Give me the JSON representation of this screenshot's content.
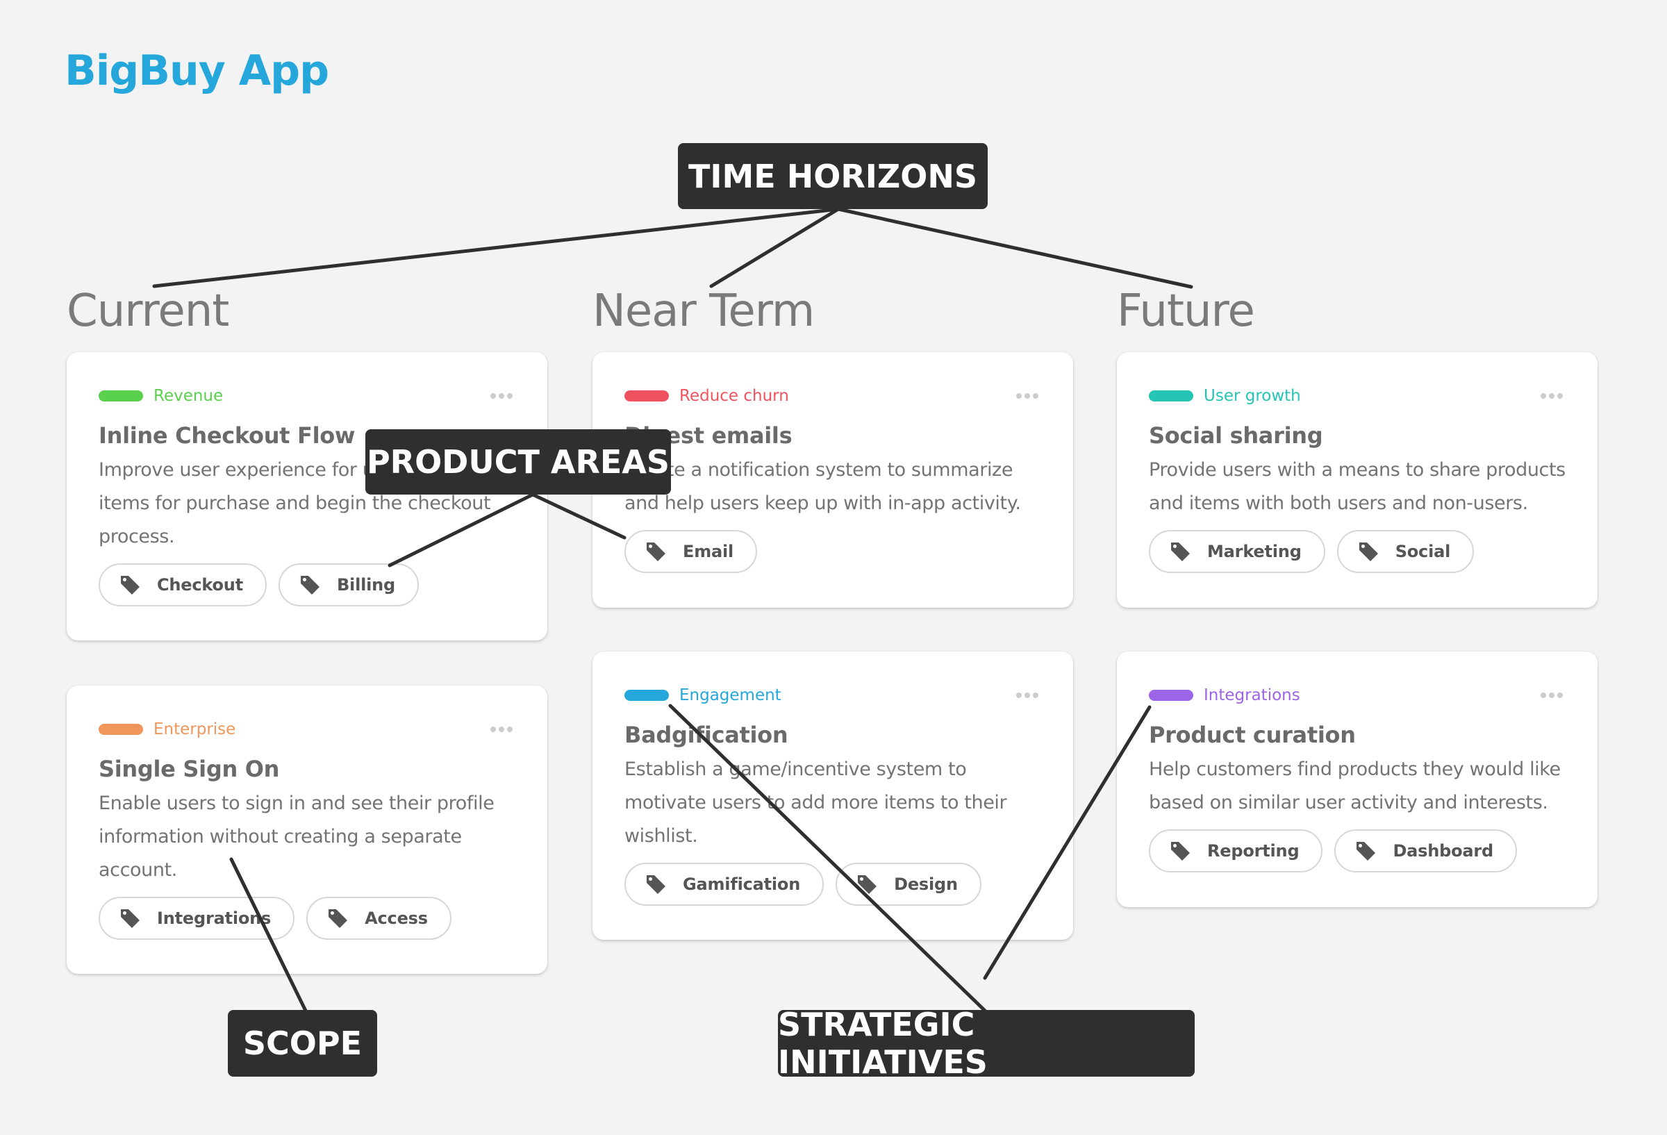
{
  "app": {
    "title": "BigBuy App",
    "accent_color": "#25a7db"
  },
  "columns": [
    {
      "heading": "Current"
    },
    {
      "heading": "Near Term"
    },
    {
      "heading": "Future"
    }
  ],
  "cards": [
    {
      "column": "Current",
      "label": {
        "text": "Revenue",
        "color": "#5ad14c"
      },
      "title": "Inline Checkout Flow",
      "description": "Improve user experience for users selecting items for purchase and begin the checkout process.",
      "tags": [
        "Checkout",
        "Billing"
      ]
    },
    {
      "column": "Current",
      "label": {
        "text": "Enterprise",
        "color": "#f0965a"
      },
      "title": "Single Sign On",
      "description": "Enable users to sign in and see their profile information without creating a separate account.",
      "tags": [
        "Integrations",
        "Access"
      ]
    },
    {
      "column": "Near Term",
      "label": {
        "text": "Reduce churn",
        "color": "#f0535f"
      },
      "title": "Digest emails",
      "description": "Create a notification system to summarize and help users keep up with in-app activity.",
      "tags": [
        "Email"
      ]
    },
    {
      "column": "Near Term",
      "label": {
        "text": "Engagement",
        "color": "#25a7db"
      },
      "title": "Badgification",
      "description": "Establish a game/incentive system to motivate users to add more items to their wishlist.",
      "tags": [
        "Gamification",
        "Design"
      ]
    },
    {
      "column": "Future",
      "label": {
        "text": "User growth",
        "color": "#26c4b4"
      },
      "title": "Social sharing",
      "description": "Provide users with a means to share products and items with both users and non-users.",
      "tags": [
        "Marketing",
        "Social"
      ]
    },
    {
      "column": "Future",
      "label": {
        "text": "Integrations",
        "color": "#9c64e6"
      },
      "title": "Product curation",
      "description": "Help customers find products they would like based on similar user activity and interests.",
      "tags": [
        "Reporting",
        "Dashboard"
      ]
    }
  ],
  "callouts": {
    "time_horizons": "TIME HORIZONS",
    "product_areas": "PRODUCT AREAS",
    "scope": "SCOPE",
    "strategic_initiatives": "STRATEGIC INITIATIVES"
  },
  "icons": {
    "more": "more-horizontal-icon",
    "tag": "tag-icon"
  }
}
